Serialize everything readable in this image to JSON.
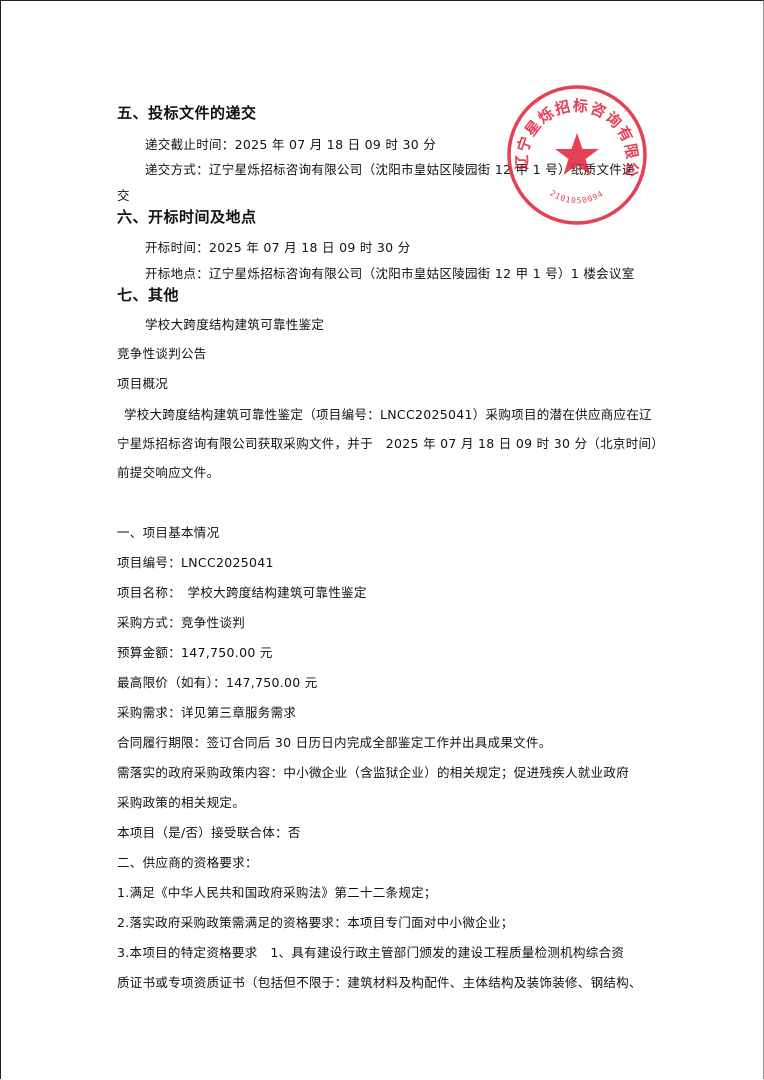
{
  "sections": {
    "s5_title": "五、投标文件的递交",
    "s5_line1": "递交截止时间：2025 年 07 月 18 日 09 时 30 分",
    "s5_line2": "递交方式：辽宁星烁招标咨询有限公司（沈阳市皇姑区陵园街 12 甲 1 号）纸质文件递",
    "s5_line3": "交",
    "s6_title": "六、开标时间及地点",
    "s6_line1": "开标时间：2025 年 07 月 18 日 09 时 30 分",
    "s6_line2": "开标地点：辽宁星烁招标咨询有限公司（沈阳市皇姑区陵园街 12 甲 1 号）1 楼会议室",
    "s7_title": "七、其他",
    "s7_line1": "学校大跨度结构建筑可靠性鉴定"
  },
  "body": {
    "l1": "竞争性谈判公告",
    "l2": "项目概况",
    "l3": "学校大跨度结构建筑可靠性鉴定（项目编号：LNCC2025041）采购项目的潜在供应商应在辽",
    "l4": "宁星烁招标咨询有限公司获取采购文件，并于　2025 年 07 月 18 日 09 时 30 分（北京时间）",
    "l5": "前提交响应文件。",
    "l6": "一、项目基本情况",
    "l7": "项目编号：LNCC2025041",
    "l8": "项目名称：　学校大跨度结构建筑可靠性鉴定",
    "l9": "采购方式：竞争性谈判",
    "l10": "预算金额：147,750.00 元",
    "l11": "最高限价（如有）：147,750.00 元",
    "l12": "采购需求：详见第三章服务需求",
    "l13": "合同履行期限：签订合同后 30 日历日内完成全部鉴定工作并出具成果文件。",
    "l14": "需落实的政府采购政策内容：中小微企业（含监狱企业）的相关规定；促进残疾人就业政府",
    "l15": "采购政策的相关规定。",
    "l16": "本项目（是/否）接受联合体：否",
    "l17": "二、供应商的资格要求：",
    "l18": "1.满足《中华人民共和国政府采购法》第二十二条规定；",
    "l19": "2.落实政府采购政策需满足的资格要求：本项目专门面对中小微企业；",
    "l20": "3.本项目的特定资格要求　1、具有建设行政主管部门颁发的建设工程质量检测机构综合资",
    "l21": "质证书或专项资质证书（包括但不限于：建筑材料及构配件、主体结构及装饰装修、钢结构、"
  },
  "stamp": {
    "text": "辽宁星烁招标咨询有限公司",
    "code": "2101050094",
    "color": "#e0203a"
  }
}
